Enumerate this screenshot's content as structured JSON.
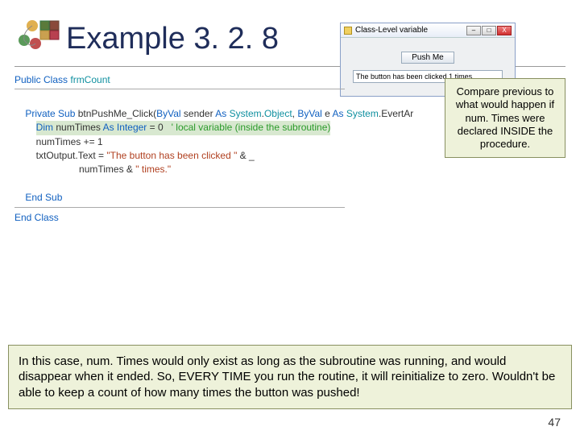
{
  "header": {
    "title": "Example 3. 2. 8"
  },
  "miniWindow": {
    "title": "Class-Level variable",
    "buttons": {
      "min": "–",
      "max": "□",
      "close": "X"
    },
    "pushLabel": "Push Me",
    "outputText": "The button has been clicked 1 times."
  },
  "code": {
    "l1_kw1": "Public Class ",
    "l1_id": "frmCount",
    "l2_kw": "Private Sub ",
    "l2_name": "btnPushMe_Click(",
    "l2_byval1": "ByVal",
    "l2_p1": " sender ",
    "l2_as1": "As ",
    "l2_t1": "System",
    "l2_dot1": ".",
    "l2_obj": "Object",
    "l2_comma": ", ",
    "l2_byval2": "ByVal",
    "l2_p2": " e ",
    "l2_as2": "As ",
    "l2_t2": "System",
    "l2_dot2": ".",
    "l2_ev": "EvertAr",
    "l3_dim": "Dim ",
    "l3_var": "numTimes ",
    "l3_as": "As Integer",
    "l3_eq": " = 0   ",
    "l3_cm": "' local variable (inside the subroutine)",
    "l4": "numTimes += 1",
    "l5a": "txtOutput.Text = ",
    "l5s1": "\"The button has been clicked \"",
    "l5amp": " & _",
    "l6a": "numTimes & ",
    "l6s": "\" times.\"",
    "l7": "End Sub",
    "l8": "End Class"
  },
  "callout1": "Compare previous to what would happen if num. Times were declared INSIDE the procedure.",
  "callout2": "In this case, num. Times would only exist as long as the subroutine was running, and would disappear when it ended. So, EVERY TIME you run the routine, it will reinitialize to zero. Wouldn't be able to keep a count of how many times the button was pushed!",
  "pageNumber": "47"
}
